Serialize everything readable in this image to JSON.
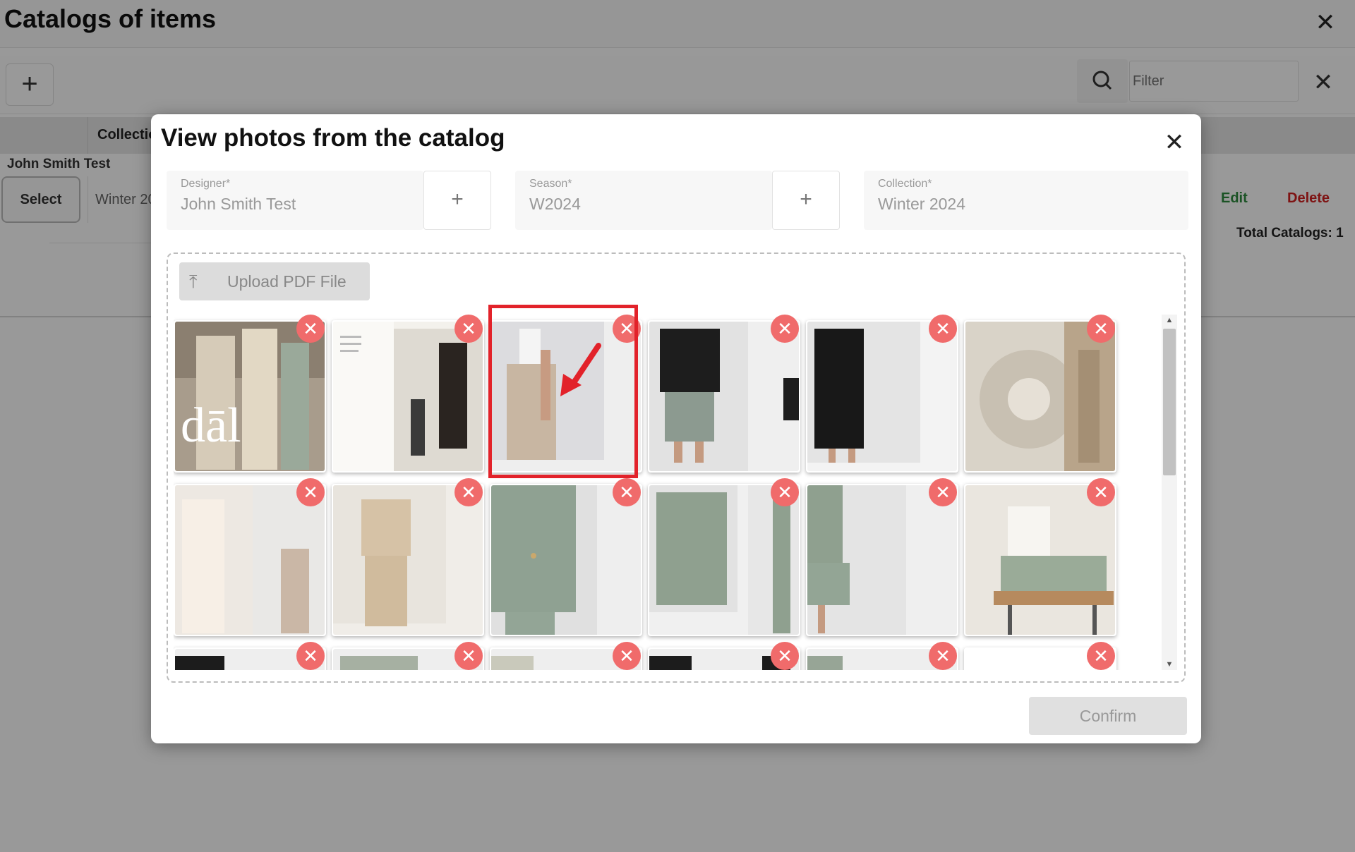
{
  "background": {
    "title": "Catalogs of items",
    "filter_placeholder": "Filter",
    "columns": {
      "collection": "Collectio"
    },
    "row": {
      "designer": "John Smith Test",
      "select_label": "Select",
      "collection": "Winter 20",
      "edit_label": "Edit",
      "delete_label": "Delete"
    },
    "total_catalogs": "Total Catalogs: 1"
  },
  "modal": {
    "title": "View photos from the catalog",
    "fields": {
      "designer": {
        "label": "Designer*",
        "value": "John Smith Test"
      },
      "season": {
        "label": "Season*",
        "value": "W2024"
      },
      "collection": {
        "label": "Collection*",
        "value": "Winter 2024"
      }
    },
    "upload_label": "Upload PDF File",
    "confirm_label": "Confirm",
    "photo_count_visible": 18,
    "highlighted_photo": 3
  },
  "colors": {
    "remove": "#f06b6b",
    "highlight": "#e2222a",
    "edit": "#2e8b3e",
    "delete": "#d32020"
  }
}
